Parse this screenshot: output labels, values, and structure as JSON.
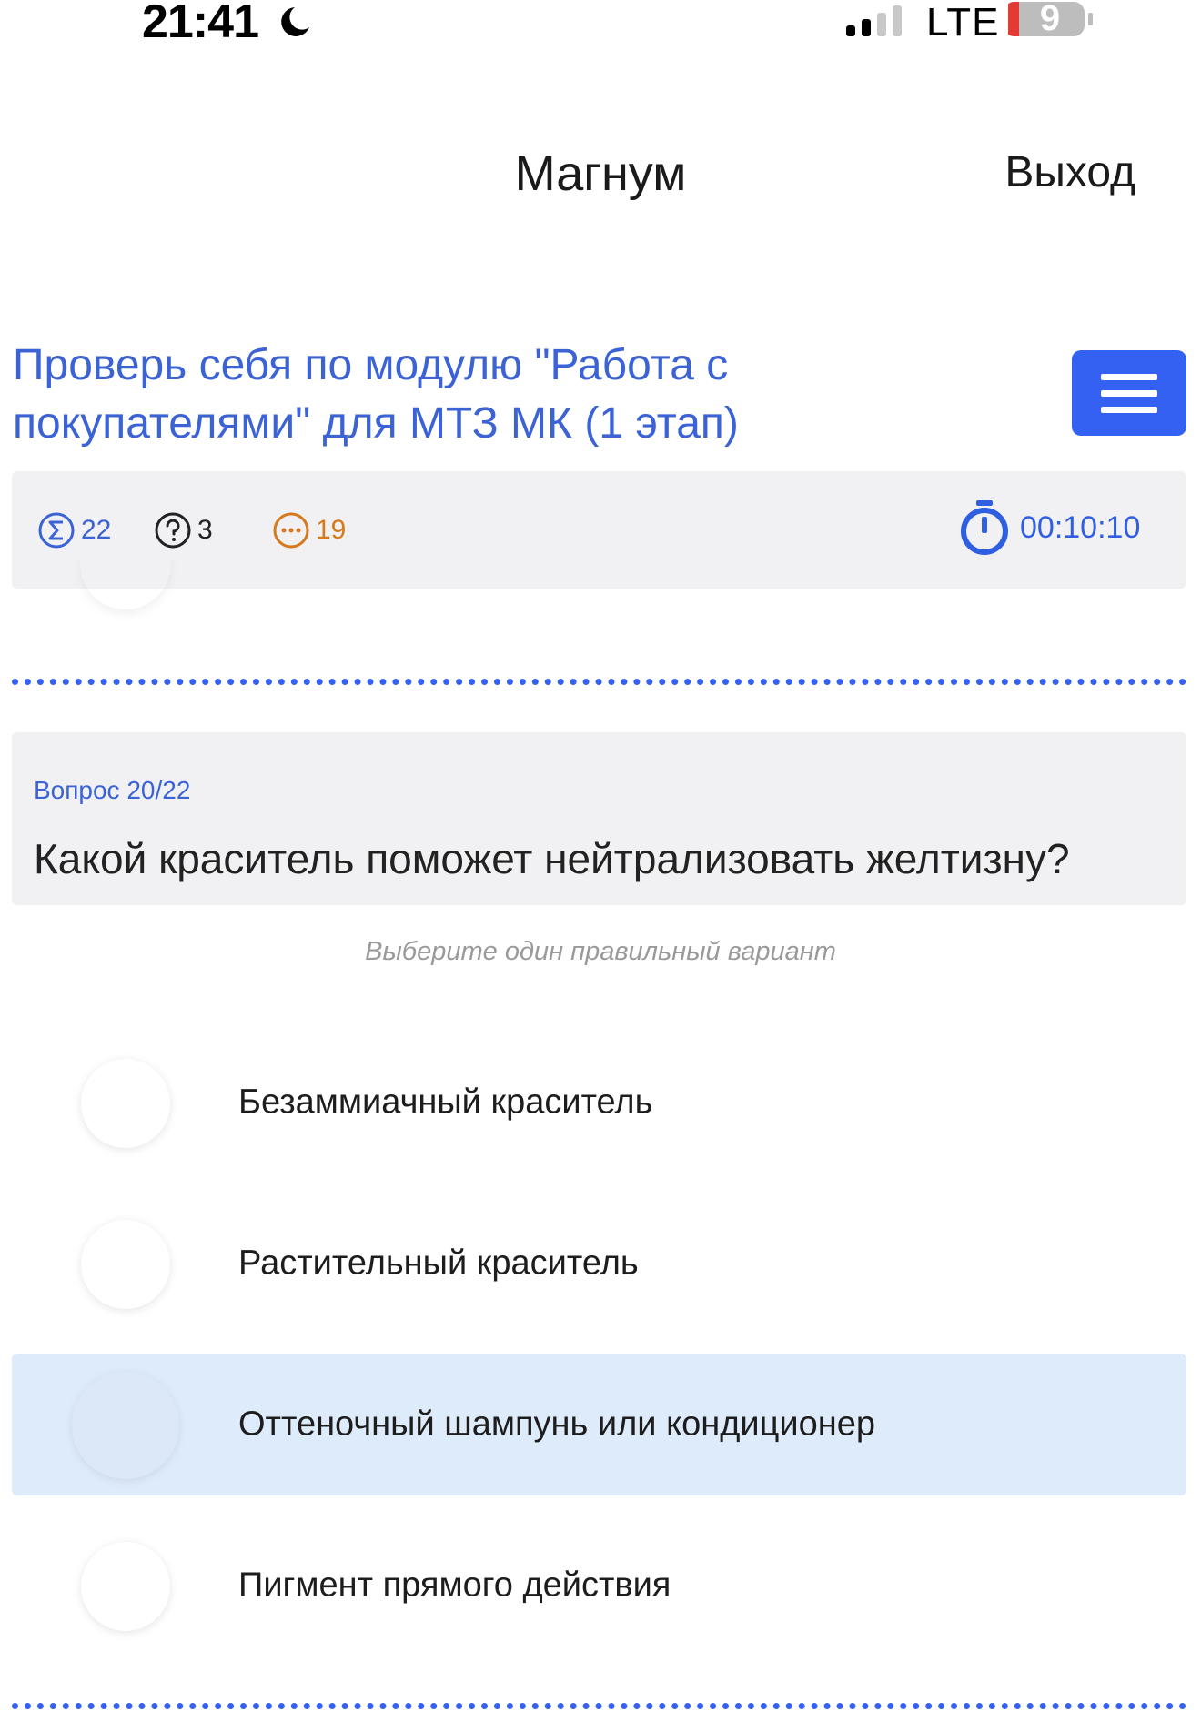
{
  "status_bar": {
    "time": "21:41",
    "network": "LTE",
    "battery": "9",
    "icons": [
      "moon-icon",
      "signal-icon",
      "battery-icon"
    ]
  },
  "header": {
    "title": "Магнум",
    "logout_label": "Выход"
  },
  "test": {
    "title": "Проверь себя по модулю \"Работа с покупателями\" для МТЗ МК (1 этап)",
    "menu_icon": "hamburger-icon"
  },
  "stats": {
    "total": "22",
    "unanswered": "3",
    "remaining": "19",
    "timer": "00:10:10"
  },
  "question": {
    "counter": "Вопрос 20/22",
    "text": "Какой краситель поможет нейтрализовать желтизну?",
    "hint": "Выберите один правильный вариант"
  },
  "options": [
    {
      "label": "Безаммиачный краситель",
      "selected": false
    },
    {
      "label": "Растительный краситель",
      "selected": false
    },
    {
      "label": "Оттеночный шампунь или кондиционер",
      "selected": true
    },
    {
      "label": "Пигмент прямого действия",
      "selected": false
    }
  ],
  "colors": {
    "accent": "#3461f2",
    "link_blue": "#3b63d6",
    "orange": "#d57a1d",
    "selected_bg": "#deebfa",
    "panel_bg": "#f1f1f3"
  }
}
